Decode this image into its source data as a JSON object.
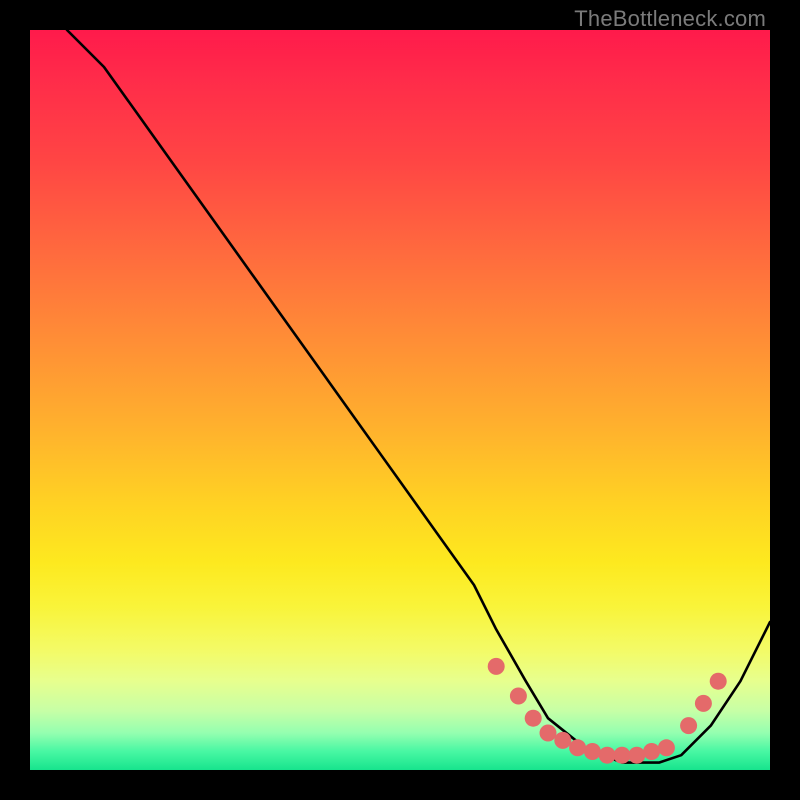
{
  "watermark": "TheBottleneck.com",
  "chart_data": {
    "type": "line",
    "title": "",
    "xlabel": "",
    "ylabel": "",
    "xlim": [
      0,
      100
    ],
    "ylim": [
      0,
      100
    ],
    "grid": false,
    "legend": false,
    "series": [
      {
        "name": "bottleneck-curve",
        "x": [
          5,
          10,
          15,
          20,
          25,
          30,
          35,
          40,
          45,
          50,
          55,
          60,
          63,
          67,
          70,
          75,
          80,
          85,
          88,
          92,
          96,
          100
        ],
        "y": [
          100,
          95,
          88,
          81,
          74,
          67,
          60,
          53,
          46,
          39,
          32,
          25,
          19,
          12,
          7,
          3,
          1,
          1,
          2,
          6,
          12,
          20
        ]
      }
    ],
    "markers": {
      "name": "highlight-dots",
      "points": [
        {
          "x": 63,
          "y": 14
        },
        {
          "x": 66,
          "y": 10
        },
        {
          "x": 68,
          "y": 7
        },
        {
          "x": 70,
          "y": 5
        },
        {
          "x": 72,
          "y": 4
        },
        {
          "x": 74,
          "y": 3
        },
        {
          "x": 76,
          "y": 2.5
        },
        {
          "x": 78,
          "y": 2
        },
        {
          "x": 80,
          "y": 2
        },
        {
          "x": 82,
          "y": 2
        },
        {
          "x": 84,
          "y": 2.5
        },
        {
          "x": 86,
          "y": 3
        },
        {
          "x": 89,
          "y": 6
        },
        {
          "x": 91,
          "y": 9
        },
        {
          "x": 93,
          "y": 12
        }
      ]
    },
    "background_gradient": {
      "top": "#ff1a4b",
      "mid": "#ffd223",
      "bottom": "#17e48d"
    }
  }
}
